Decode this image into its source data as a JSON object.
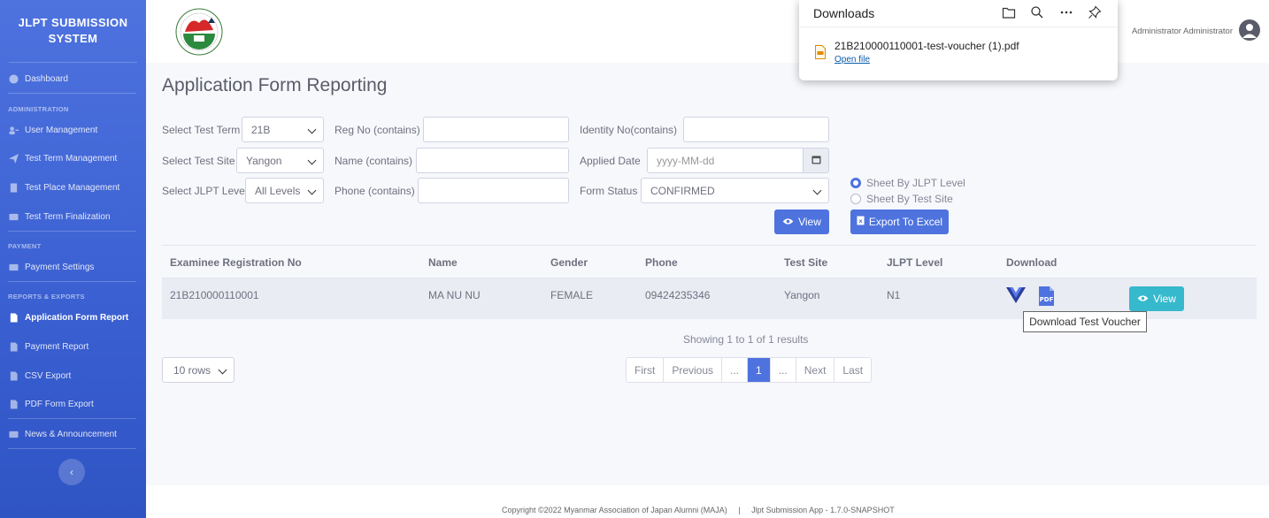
{
  "sidebar": {
    "brand_line1": "JLPT SUBMISSION",
    "brand_line2": "SYSTEM",
    "dashboard": "Dashboard",
    "heading_admin": "ADMINISTRATION",
    "user_management": "User Management",
    "test_term_management": "Test Term Management",
    "test_place_management": "Test Place Management",
    "test_term_finalization": "Test Term Finalization",
    "heading_payment": "PAYMENT",
    "payment_settings": "Payment Settings",
    "heading_reports": "REPORTS & EXPORTS",
    "application_form_report": "Application Form Report",
    "payment_report": "Payment Report",
    "csv_export": "CSV Export",
    "pdf_form_export": "PDF Form Export",
    "news_announcement": "News & Announcement",
    "collapse_icon": "chevron-left-icon"
  },
  "topbar": {
    "user_name": "Administrator Administrator",
    "avatar_icon": "user-circle-icon"
  },
  "downloads": {
    "title": "Downloads",
    "file_name": "21B210000110001-test-voucher (1).pdf",
    "open_file": "Open file",
    "icons": [
      "folder-icon",
      "search-icon",
      "more-icon",
      "pin-icon"
    ]
  },
  "page": {
    "title": "Application Form Reporting"
  },
  "filters": {
    "test_term_label": "Select Test Term",
    "test_term_value": "21B",
    "test_site_label": "Select Test Site",
    "test_site_value": "Yangon",
    "jlpt_level_label": "Select JLPT Level",
    "jlpt_level_value": "All Levels",
    "reg_no_label": "Reg No (contains)",
    "reg_no_value": "",
    "name_label": "Name (contains)",
    "name_value": "",
    "phone_label": "Phone (contains)",
    "phone_value": "",
    "identity_label": "Identity No(contains)",
    "identity_value": "",
    "applied_date_label": "Applied Date",
    "applied_date_placeholder": "yyyy-MM-dd",
    "form_status_label": "Form Status",
    "form_status_value": "CONFIRMED",
    "sheet_by_level": "Sheet By JLPT Level",
    "sheet_by_site": "Sheet By Test Site",
    "selected_sheet": "Sheet By JLPT Level",
    "view_button": "View",
    "export_button": "Export To Excel"
  },
  "table": {
    "headers": [
      "Examinee Registration No",
      "Name",
      "Gender",
      "Phone",
      "Test Site",
      "JLPT Level",
      "Download"
    ],
    "rows": [
      {
        "reg_no": "21B210000110001",
        "name": "MA NU NU",
        "gender": "FEMALE",
        "phone": "09424235346",
        "test_site": "Yangon",
        "level": "N1",
        "view_button": "View"
      }
    ],
    "tooltip": "Download Test Voucher"
  },
  "pagination": {
    "showing": "Showing 1 to 1 of 1 results",
    "rows_per_page": "10 rows",
    "first": "First",
    "previous": "Previous",
    "ellipsis_left": "...",
    "current": "1",
    "ellipsis_right": "...",
    "next": "Next",
    "last": "Last"
  },
  "footer": {
    "copyright": "Copyright ©2022 Myanmar Association of Japan Alumni (MAJA)",
    "separator": "|",
    "app_version": "Jlpt Submission App - 1.7.0-SNAPSHOT"
  },
  "colors": {
    "primary": "#4e73df",
    "info": "#36b9cc",
    "background": "#f7f8fc"
  }
}
